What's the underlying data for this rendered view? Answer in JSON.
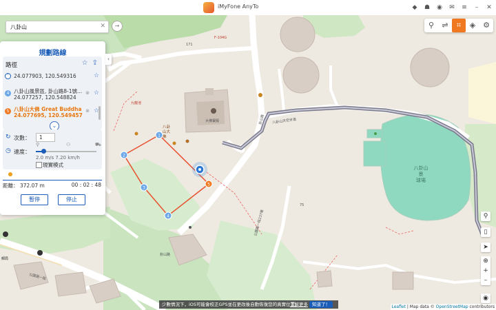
{
  "app": {
    "title": "iMyFone AnyTo"
  },
  "search": {
    "value": "八卦山",
    "clear_icon": "close-icon",
    "go_icon": "arrow-right-icon"
  },
  "panel": {
    "title": "規劃路線",
    "route_label": "路徑",
    "waypoints": [
      {
        "name": "",
        "coord": "24.077903, 120.549316",
        "marker": "start-pin"
      },
      {
        "name": "八卦山風景區, 卦山路8-1號...",
        "coord": "24.077257, 120.548824",
        "marker": "4"
      },
      {
        "name": "八卦山大佛 Great Buddha ...",
        "coord": "24.077695, 120.549457",
        "marker": "5",
        "active": true
      }
    ],
    "count_label": "次數：",
    "count_value": "1",
    "speed_label": "速度：",
    "speed_value": "2.0 m/s  7.20 km/h",
    "speed_fraction": 0.13,
    "realistic_label": "現實模式",
    "distance": "距離： 372.07 m",
    "time": "00 : 02 : 48",
    "pause_label": "暫停",
    "stop_label": "停止"
  },
  "map_labels": {
    "road_kuashan": "卦山路",
    "road_tiankong": "八卦山天空步道",
    "stadium": "八卦山景\n球場",
    "temple": "大佛寶殿",
    "buddha": "八卦山大佛",
    "road_east": "公園路一段237巷",
    "road_west": "公園路一段",
    "f104": "F-104G",
    "n171": "171",
    "n75": "75",
    "n139": "139",
    "pavilion": "九龍池",
    "bottom_road": "卦山路",
    "station": "郵局"
  },
  "mode_icons": [
    "teleport-icon",
    "multi-stop-icon",
    "jump-icon",
    "joystick-icon",
    "settings-icon"
  ],
  "notice": {
    "text": "少數情況下，iOS可能會校正GPS並在更改後自動恢復您的真實位置。",
    "link": "了解更多",
    "button": "知道了！"
  },
  "attribution": {
    "leaflet": "Leaflet",
    "text": " | Map data © ",
    "osm": "OpenStreetMap",
    "suffix": " contributors"
  },
  "colors": {
    "accent": "#1a5db8",
    "route": "#e8502e",
    "active": "#f07820",
    "stadium": "#8fd9c0"
  }
}
